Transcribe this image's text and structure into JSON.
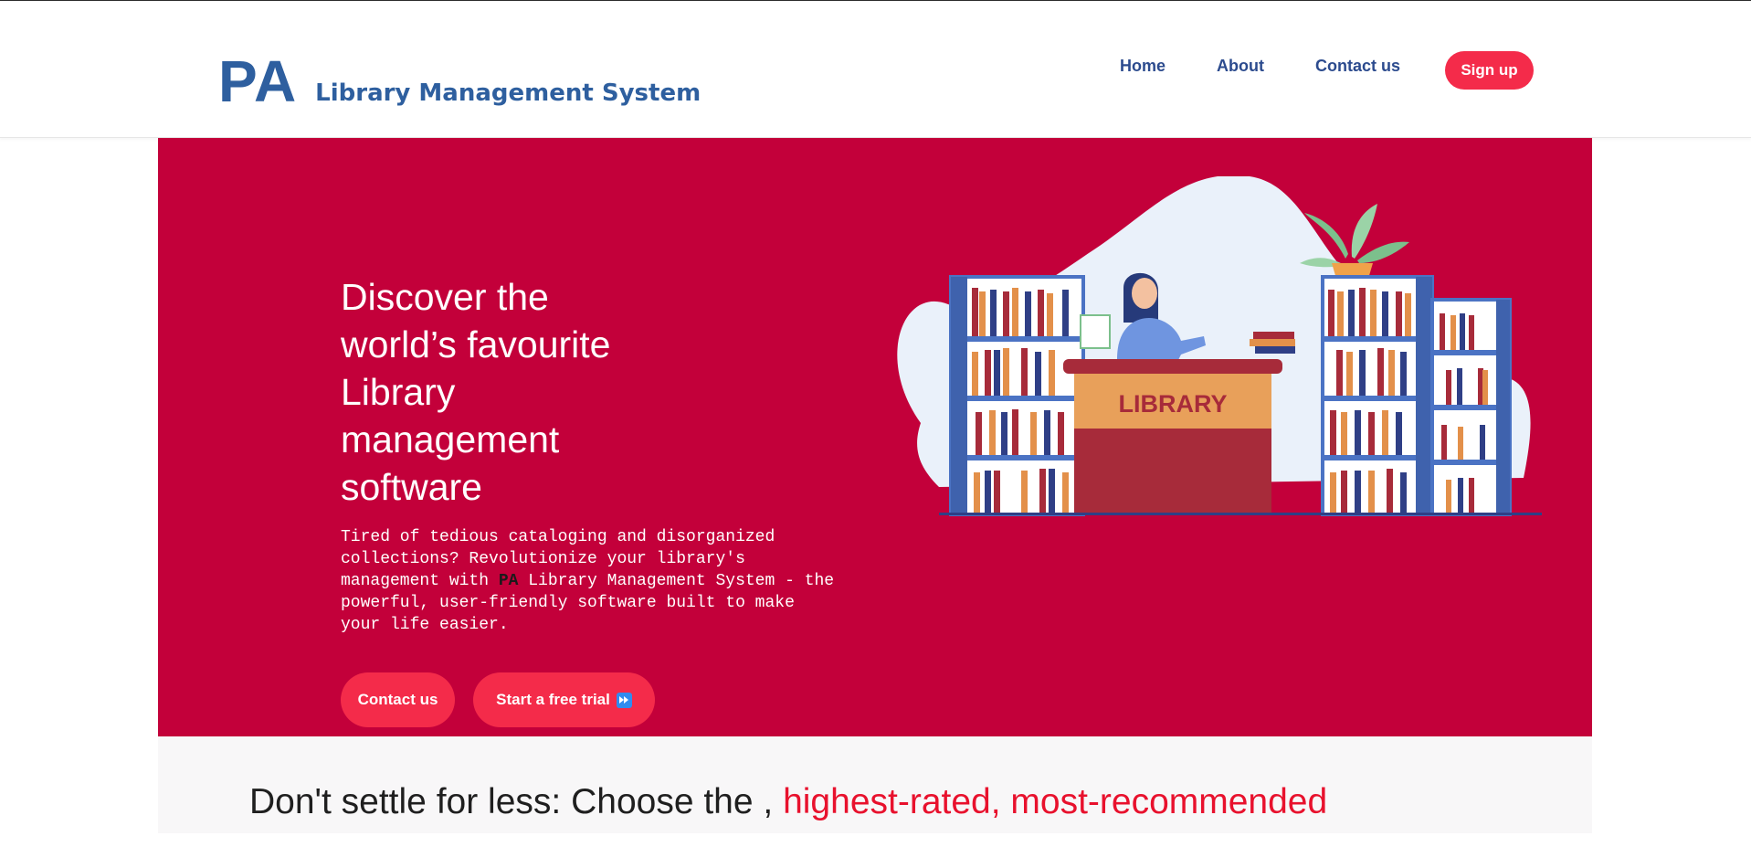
{
  "header": {
    "brand_mark": "PA",
    "brand_name": "Library Management System",
    "nav": [
      {
        "label": "Home"
      },
      {
        "label": "About"
      },
      {
        "label": "Contact us"
      }
    ],
    "signup_label": "Sign up"
  },
  "hero": {
    "title": "Discover the world’s favourite Library management software",
    "description_before": "Tired of tedious cataloging and disorganized collections? Revolutionize your library's management with ",
    "description_brand": "PA",
    "description_after": " Library Management System - the powerful, user-friendly software built to make your life easier.",
    "contact_button": "Contact us",
    "trial_button": "Start a free trial",
    "trial_icon": "fast-forward-icon",
    "illustration_desk_label": "LIBRARY"
  },
  "tagline": {
    "text": "Don't settle for less: Choose the ,",
    "highlight": "highest-rated, most-recommended"
  },
  "colors": {
    "brand_blue": "#2e5f9f",
    "nav_blue": "#2c4b8e",
    "hero_red": "#c3003a",
    "button_red": "#f42b4a",
    "highlight_red": "#e8112d"
  }
}
